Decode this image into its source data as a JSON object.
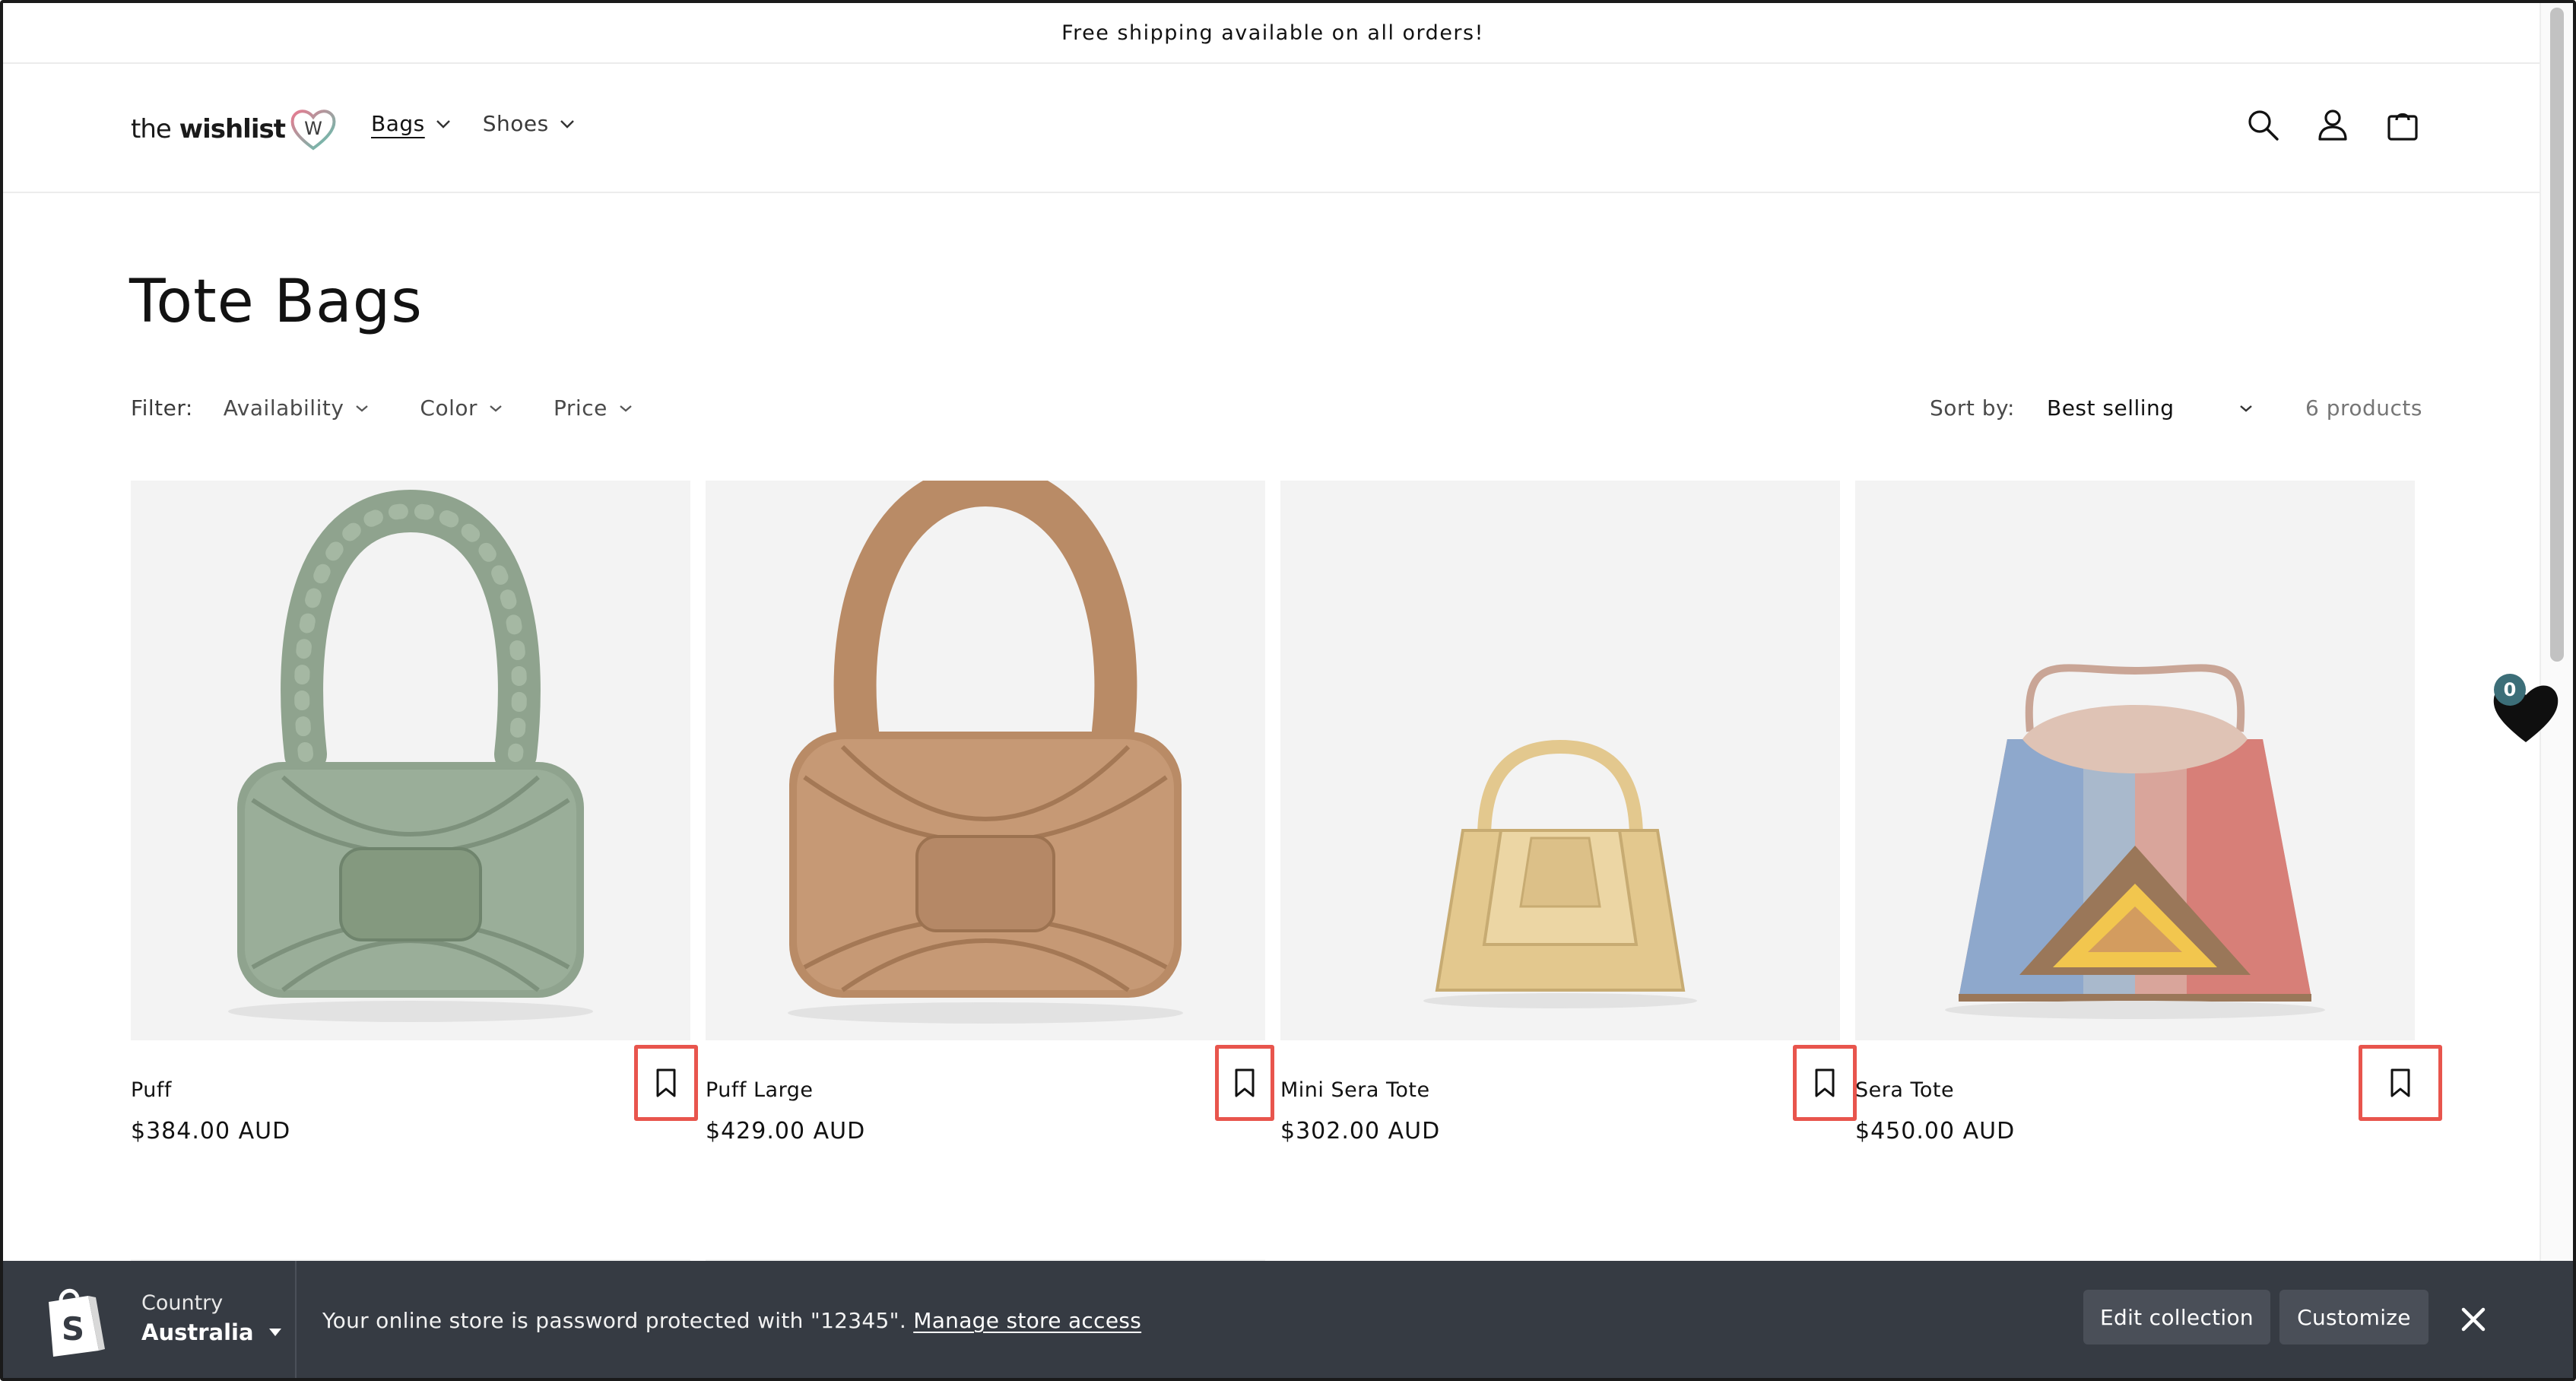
{
  "announcement": "Free shipping available on all orders!",
  "header": {
    "logo_text_bold": "the",
    "logo_text": "wishlist",
    "logo_heart_letter": "W",
    "nav": [
      {
        "label": "Bags"
      },
      {
        "label": "Shoes"
      }
    ],
    "icons": [
      "search-icon",
      "account-icon",
      "cart-icon"
    ]
  },
  "collection": {
    "title": "Tote Bags",
    "filter_label": "Filter:",
    "filters": [
      "Availability",
      "Color",
      "Price"
    ],
    "sort_label": "Sort by:",
    "sort_value": "Best selling",
    "product_count": "6 products"
  },
  "products": [
    {
      "name": "Puff",
      "price": "$384.00 AUD",
      "color": "#8fa38e"
    },
    {
      "name": "Puff Large",
      "price": "$429.00 AUD",
      "color": "#b98b66"
    },
    {
      "name": "Mini Sera Tote",
      "price": "$302.00 AUD",
      "color": "#e3c88e"
    },
    {
      "name": "Sera Tote",
      "price": "$450.00 AUD",
      "color": "#d9a59b"
    }
  ],
  "wishlist_fab": {
    "count": "0",
    "icon": "heart-icon"
  },
  "admin_bar": {
    "country_label": "Country",
    "country_value": "Australia",
    "message": "Your online store is password protected with \"12345\".",
    "link": "Manage store access",
    "edit_button": "Edit collection",
    "customize_button": "Customize"
  },
  "colors": {
    "highlight_box": "#e8554d",
    "admin_bar_bg": "#363b43",
    "badge_bg": "#3c6e78"
  }
}
